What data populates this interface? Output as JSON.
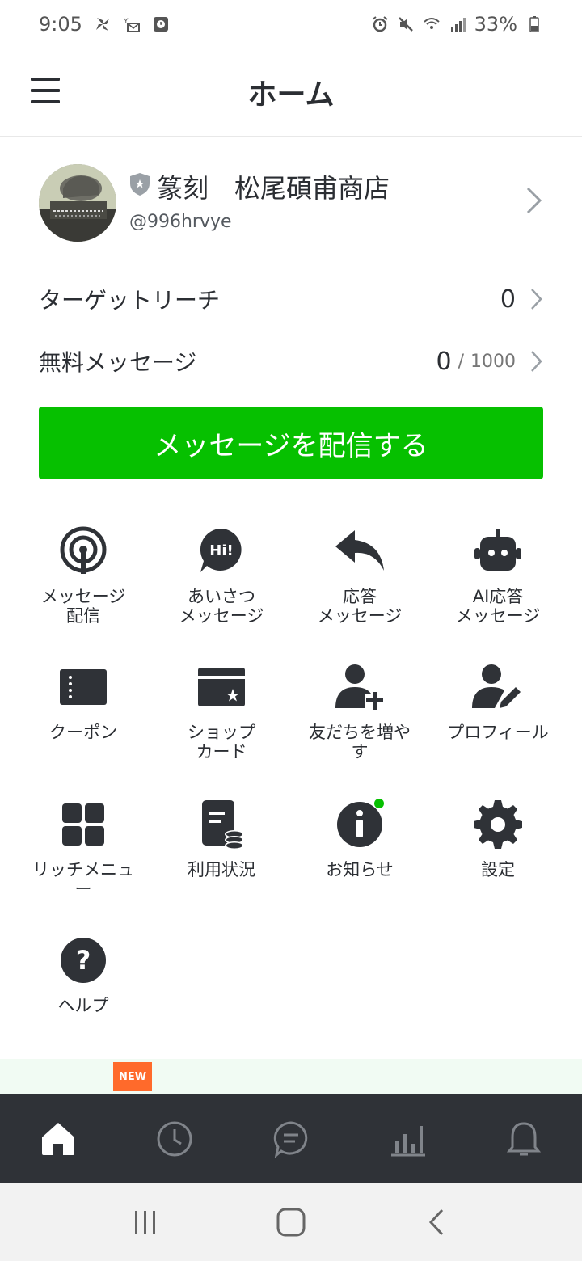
{
  "status_bar": {
    "time": "9:05",
    "battery": "33%"
  },
  "header": {
    "title": "ホーム",
    "menu_icon": "hamburger-menu-icon"
  },
  "account": {
    "name": "篆刻　松尾碩甫商店",
    "id": "@996hrvye"
  },
  "stats": {
    "target_reach_label": "ターゲットリーチ",
    "target_reach_value": "0",
    "free_messages_label": "無料メッセージ",
    "free_messages_used": "0",
    "free_messages_sep": "/",
    "free_messages_limit": "1000"
  },
  "cta": {
    "label": "メッセージを配信する",
    "color": "#06c000"
  },
  "grid": {
    "items": [
      {
        "label": "メッセージ\n配信",
        "icon": "broadcast-icon"
      },
      {
        "label": "あいさつ\nメッセージ",
        "icon": "hi-bubble-icon"
      },
      {
        "label": "応答\nメッセージ",
        "icon": "reply-arrow-icon"
      },
      {
        "label": "AI応答\nメッセージ",
        "icon": "robot-icon"
      },
      {
        "label": "クーポン",
        "icon": "coupon-icon"
      },
      {
        "label": "ショップ\nカード",
        "icon": "shop-card-icon"
      },
      {
        "label": "友だちを増や\nす",
        "icon": "add-friend-icon"
      },
      {
        "label": "プロフィール",
        "icon": "profile-edit-icon"
      },
      {
        "label": "リッチメニュ\nー",
        "icon": "rich-menu-icon"
      },
      {
        "label": "利用状況",
        "icon": "usage-icon"
      },
      {
        "label": "お知らせ",
        "icon": "info-icon"
      },
      {
        "label": "設定",
        "icon": "gear-icon"
      },
      {
        "label": "ヘルプ",
        "icon": "help-icon"
      }
    ]
  },
  "banner": {
    "badge": "NEW"
  },
  "bottom_nav": {
    "items": [
      {
        "icon": "home-icon",
        "active": true
      },
      {
        "icon": "clock-icon",
        "active": false
      },
      {
        "icon": "chat-icon",
        "active": false
      },
      {
        "icon": "chart-icon",
        "active": false
      },
      {
        "icon": "bell-icon",
        "active": false
      }
    ]
  },
  "system_nav": {
    "items": [
      "recent-apps-icon",
      "home-button-icon",
      "back-icon"
    ]
  }
}
